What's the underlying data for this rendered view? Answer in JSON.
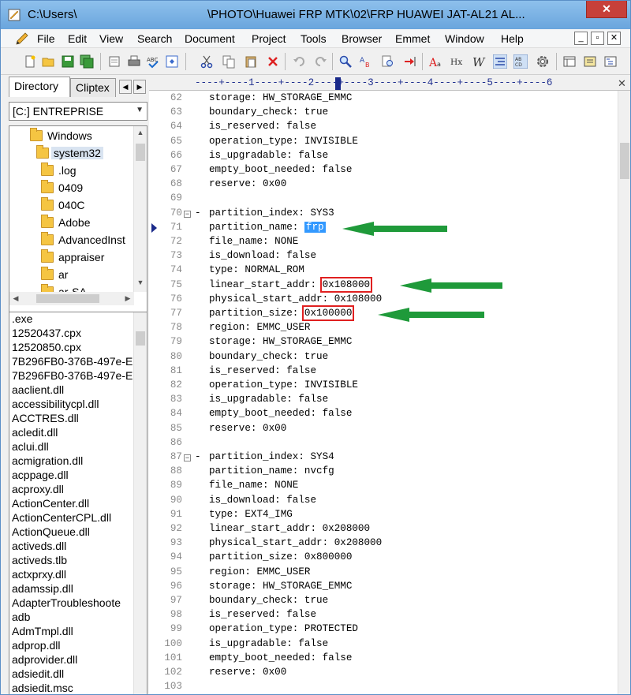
{
  "window": {
    "title_left": "C:\\Users\\",
    "title_right": "\\PHOTO\\Huawei FRP MTK\\02\\FRP HUAWEI JAT-AL21 AL...",
    "close_glyph": "✕"
  },
  "menu": [
    "File",
    "Edit",
    "View",
    "Search",
    "Document",
    "Project",
    "Tools",
    "Browser",
    "Emmet",
    "Window",
    "Help"
  ],
  "mdi_buttons": [
    "_",
    "▫",
    "✕"
  ],
  "tabs": {
    "directory": "Directory",
    "cliptext": "Cliptex",
    "prev": "◀",
    "next": "▶"
  },
  "drive": "[C:] ENTREPRISE",
  "tree": [
    {
      "label": "Windows",
      "selected": false
    },
    {
      "label": "system32",
      "selected": true
    },
    {
      "label": ".log",
      "selected": false
    },
    {
      "label": "0409",
      "selected": false
    },
    {
      "label": "040C",
      "selected": false
    },
    {
      "label": "Adobe",
      "selected": false
    },
    {
      "label": "AdvancedInst",
      "selected": false
    },
    {
      "label": "appraiser",
      "selected": false
    },
    {
      "label": "ar",
      "selected": false
    },
    {
      "label": "ar-SA",
      "selected": false
    }
  ],
  "files": [
    ".exe",
    "12520437.cpx",
    "12520850.cpx",
    "7B296FB0-376B-497e-E",
    "7B296FB0-376B-497e-E",
    "aaclient.dll",
    "accessibilitycpl.dll",
    "ACCTRES.dll",
    "acledit.dll",
    "aclui.dll",
    "acmigration.dll",
    "acppage.dll",
    "acproxy.dll",
    "ActionCenter.dll",
    "ActionCenterCPL.dll",
    "ActionQueue.dll",
    "activeds.dll",
    "activeds.tlb",
    "actxprxy.dll",
    "adamssip.dll",
    "AdapterTroubleshoote",
    "adb",
    "AdmTmpl.dll",
    "adprop.dll",
    "adprovider.dll",
    "adsiedit.dll",
    "adsiedit.msc"
  ],
  "ruler": {
    "marks": "----+----1----+----2----+----3----+----4----+----5----+----6",
    "close": "✕"
  },
  "code": [
    {
      "n": "62",
      "text": "storage: HW_STORAGE_EMMC"
    },
    {
      "n": "63",
      "text": "boundary_check: true"
    },
    {
      "n": "64",
      "text": "is_reserved: false"
    },
    {
      "n": "65",
      "text": "operation_type: INVISIBLE"
    },
    {
      "n": "66",
      "text": "is_upgradable: false"
    },
    {
      "n": "67",
      "text": "empty_boot_needed: false"
    },
    {
      "n": "68",
      "text": "reserve: 0x00"
    },
    {
      "n": "69",
      "text": ""
    },
    {
      "n": "70",
      "text": "partition_index: SYS3",
      "fold": true
    },
    {
      "n": "71",
      "text": "partition_name: ",
      "highlight": "frp",
      "bookmark": true
    },
    {
      "n": "72",
      "text": "file_name: NONE"
    },
    {
      "n": "73",
      "text": "is_download: false"
    },
    {
      "n": "74",
      "text": "type: NORMAL_ROM"
    },
    {
      "n": "75",
      "text": "linear_start_addr: ",
      "boxed": "0x108000"
    },
    {
      "n": "76",
      "text": "physical_start_addr: 0x108000"
    },
    {
      "n": "77",
      "text": "partition_size: ",
      "boxed": "0x100000"
    },
    {
      "n": "78",
      "text": "region: EMMC_USER"
    },
    {
      "n": "79",
      "text": "storage: HW_STORAGE_EMMC"
    },
    {
      "n": "80",
      "text": "boundary_check: true"
    },
    {
      "n": "81",
      "text": "is_reserved: false"
    },
    {
      "n": "82",
      "text": "operation_type: INVISIBLE"
    },
    {
      "n": "83",
      "text": "is_upgradable: false"
    },
    {
      "n": "84",
      "text": "empty_boot_needed: false"
    },
    {
      "n": "85",
      "text": "reserve: 0x00"
    },
    {
      "n": "86",
      "text": ""
    },
    {
      "n": "87",
      "text": "partition_index: SYS4",
      "fold": true
    },
    {
      "n": "88",
      "text": "partition_name: nvcfg"
    },
    {
      "n": "89",
      "text": "file_name: NONE"
    },
    {
      "n": "90",
      "text": "is_download: false"
    },
    {
      "n": "91",
      "text": "type: EXT4_IMG"
    },
    {
      "n": "92",
      "text": "linear_start_addr: 0x208000"
    },
    {
      "n": "93",
      "text": "physical_start_addr: 0x208000"
    },
    {
      "n": "94",
      "text": "partition_size: 0x800000"
    },
    {
      "n": "95",
      "text": "region: EMMC_USER"
    },
    {
      "n": "96",
      "text": "storage: HW_STORAGE_EMMC"
    },
    {
      "n": "97",
      "text": "boundary_check: true"
    },
    {
      "n": "98",
      "text": "is_reserved: false"
    },
    {
      "n": "99",
      "text": "operation_type: PROTECTED"
    },
    {
      "n": "100",
      "text": "is_upgradable: false"
    },
    {
      "n": "101",
      "text": "empty_boot_needed: false"
    },
    {
      "n": "102",
      "text": "reserve: 0x00"
    },
    {
      "n": "103",
      "text": ""
    }
  ],
  "colors": {
    "selection": "#3399ff",
    "annotation_box": "#e02020",
    "annotation_arrow": "#1f9a3a",
    "titlebar": "#7eb4e6"
  },
  "icons": [
    "new-file-icon",
    "open-folder-icon",
    "save-icon",
    "save-all-icon",
    "print-preview-icon",
    "print-icon",
    "spellcheck-icon",
    "browser-view-icon",
    "cut-icon",
    "copy-icon",
    "paste-icon",
    "delete-icon",
    "undo-icon",
    "redo-icon",
    "find-icon",
    "replace-icon",
    "find-in-files-icon",
    "goto-icon",
    "font-icon",
    "hex-icon",
    "word-wrap-icon",
    "indent-guide-icon",
    "column-icon",
    "settings-icon",
    "panel-icon",
    "clip-panel-icon",
    "outline-icon"
  ]
}
